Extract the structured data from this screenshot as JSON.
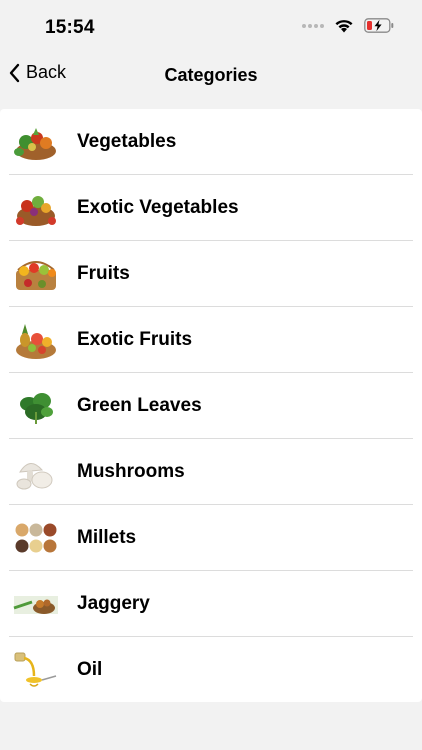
{
  "status": {
    "time": "15:54",
    "icons": [
      "cellular-dots-icon",
      "wifi-icon",
      "battery-charging-icon"
    ],
    "battery_color": "#e5312f"
  },
  "nav": {
    "back_label": "Back",
    "title": "Categories"
  },
  "categories": [
    {
      "label": "Vegetables",
      "icon": "vegetables-basket-image"
    },
    {
      "label": "Exotic Vegetables",
      "icon": "exotic-vegetables-basket-image"
    },
    {
      "label": "Fruits",
      "icon": "fruits-basket-image"
    },
    {
      "label": "Exotic Fruits",
      "icon": "exotic-fruits-basket-image"
    },
    {
      "label": "Green Leaves",
      "icon": "green-leaves-image"
    },
    {
      "label": "Mushrooms",
      "icon": "mushrooms-image"
    },
    {
      "label": "Millets",
      "icon": "millets-bowls-image"
    },
    {
      "label": "Jaggery",
      "icon": "jaggery-image"
    },
    {
      "label": "Oil",
      "icon": "oil-pour-image"
    }
  ]
}
